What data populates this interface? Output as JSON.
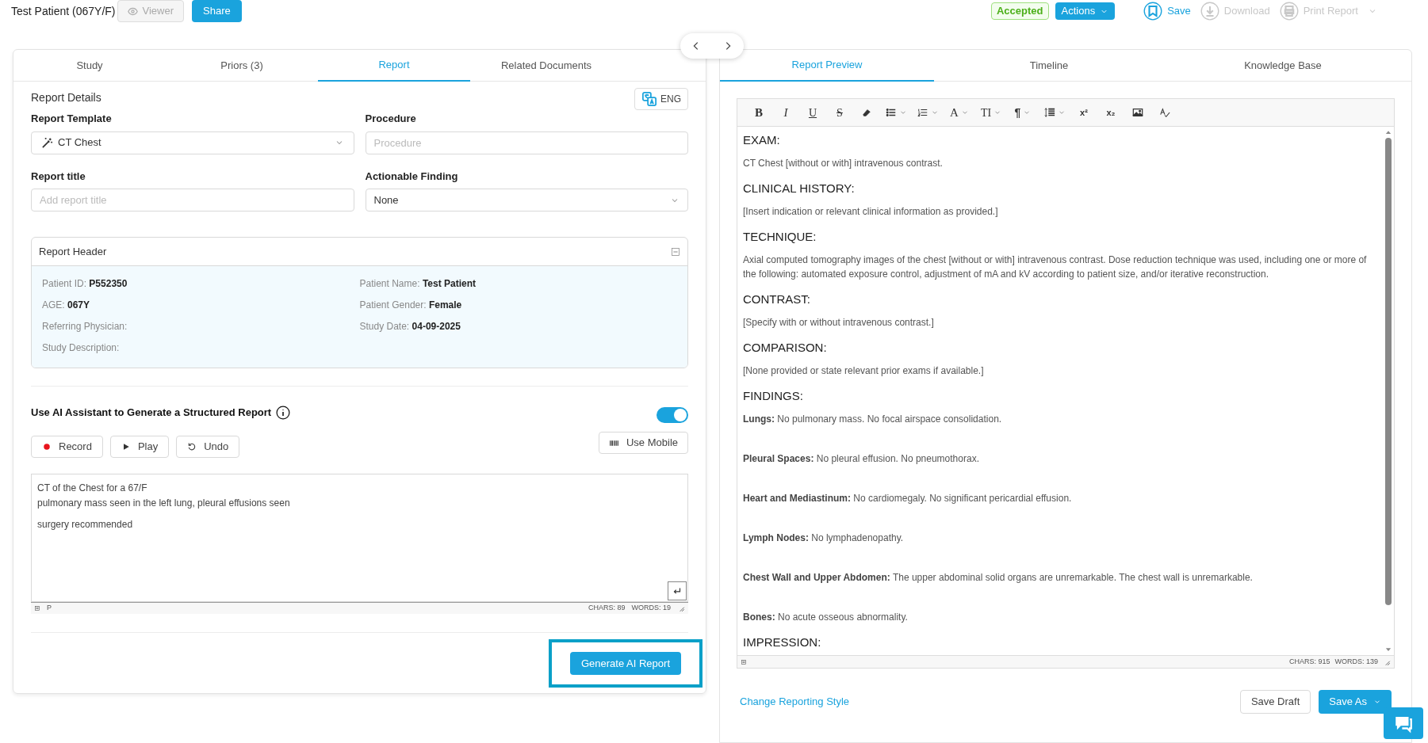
{
  "topbar": {
    "patient": "Test Patient (067Y/F)",
    "viewer": {
      "label": "Viewer",
      "disabled": true
    },
    "share": "Share",
    "status": "Accepted",
    "actions": "Actions",
    "tools": [
      {
        "kind": "save",
        "label": "Save",
        "disabled": false
      },
      {
        "kind": "download",
        "label": "Download",
        "disabled": true
      },
      {
        "kind": "print",
        "label": "Print Report",
        "disabled": true
      }
    ]
  },
  "left_tabs": [
    {
      "label": "Study",
      "selected": false
    },
    {
      "label": "Priors (3)",
      "selected": false
    },
    {
      "label": "Report",
      "selected": true
    },
    {
      "label": "Related Documents",
      "selected": false
    }
  ],
  "details": {
    "title": "Report Details",
    "language": "ENG",
    "template_label": "Report Template",
    "template": "CT Chest",
    "procedure_label": "Procedure",
    "procedure_placeholder": "Procedure",
    "title_label": "Report title",
    "title_placeholder": "Add report title",
    "finding_label": "Actionable Finding",
    "finding": "None"
  },
  "report_header": {
    "title": "Report Header",
    "expanded": true,
    "left": [
      {
        "label": "Patient ID:",
        "value": "P552350"
      },
      {
        "label": "AGE:",
        "value": "067Y"
      },
      {
        "label": "Referring Physician:"
      },
      {
        "label": "Study Description:"
      }
    ],
    "right": [
      {
        "label": "Patient Name:",
        "value": "Test Patient"
      },
      {
        "label": "Patient Gender:",
        "value": "Female"
      },
      {
        "label": "Study Date:",
        "value": "04-09-2025"
      }
    ]
  },
  "ai": {
    "label": "Use AI Assistant to Generate a Structured Report",
    "on": true,
    "buttons": [
      {
        "kind": "record",
        "label": "Record"
      },
      {
        "kind": "play",
        "label": "Play"
      },
      {
        "kind": "undo",
        "label": "Undo"
      }
    ],
    "mobile": "Use Mobile",
    "paragraphs": [
      [
        "CT of the Chest for a 67/F",
        "pulmonary mass seen in the left lung, pleural effusions seen"
      ],
      [
        "surgery recommended"
      ]
    ],
    "path": "P",
    "chars": "CHARS: 89",
    "words": "WORDS: 19",
    "generate": "Generate AI Report"
  },
  "right_tabs": [
    {
      "label": "Report Preview",
      "selected": true
    },
    {
      "label": "Timeline",
      "selected": false
    },
    {
      "label": "Knowledge Base",
      "selected": false
    }
  ],
  "toolbar": [
    {
      "kind": "bold",
      "glyph": "B",
      "dropdown": false
    },
    {
      "kind": "italic",
      "glyph": "I",
      "dropdown": false
    },
    {
      "kind": "underline",
      "glyph": "U",
      "dropdown": false
    },
    {
      "kind": "strike",
      "glyph": "S",
      "dropdown": false
    },
    {
      "kind": "eraser",
      "dropdown": false
    },
    {
      "kind": "bullets",
      "dropdown": true
    },
    {
      "kind": "numbers",
      "dropdown": true
    },
    {
      "kind": "font",
      "glyph": "A",
      "dropdown": true
    },
    {
      "kind": "size",
      "glyph": "TI",
      "dropdown": true
    },
    {
      "kind": "paragraph",
      "glyph": "¶",
      "dropdown": true
    },
    {
      "kind": "lineheight",
      "dropdown": true
    },
    {
      "kind": "sup",
      "glyph": "x²",
      "dropdown": false
    },
    {
      "kind": "sub",
      "glyph": "x₂",
      "dropdown": false
    },
    {
      "kind": "image",
      "dropdown": false
    },
    {
      "kind": "spell",
      "dropdown": false
    }
  ],
  "preview": [
    {
      "heading": "EXAM:",
      "paragraphs": [
        "CT Chest [without or with] intravenous contrast."
      ]
    },
    {
      "heading": "CLINICAL HISTORY:",
      "paragraphs": [
        "[Insert indication or relevant clinical information as provided.]"
      ]
    },
    {
      "heading": "TECHNIQUE:",
      "paragraphs": [
        "Axial computed tomography images of the chest [without or with] intravenous contrast. Dose reduction technique was used, including one or more of the following: automated exposure control, adjustment of mA and kV according to patient size, and/or iterative reconstruction."
      ]
    },
    {
      "heading": "CONTRAST:",
      "paragraphs": [
        "[Specify with or without intravenous contrast.]"
      ]
    },
    {
      "heading": "COMPARISON:",
      "paragraphs": [
        "[None provided or state relevant prior exams if available.]"
      ]
    },
    {
      "heading": "FINDINGS:",
      "paragraphs": [
        "**Lungs:** No pulmonary mass. No focal airspace consolidation.",
        "**Pleural Spaces:** No pleural effusion. No pneumothorax.",
        "**Heart and Mediastinum:** No cardiomegaly. No significant pericardial effusion.",
        "**Lymph Nodes:** No lymphadenopathy.",
        "**Chest Wall and Upper Abdomen:** The upper abdominal solid organs are unremarkable. The chest wall is unremarkable.",
        "**Bones:** No acute osseous abnormality."
      ]
    },
    {
      "heading": "IMPRESSION:"
    }
  ],
  "preview_status": {
    "chars": "CHARS: 915",
    "words": "WORDS: 139"
  },
  "footer": {
    "link": "Change Reporting Style",
    "draft": "Save Draft",
    "save_as": "Save As"
  }
}
